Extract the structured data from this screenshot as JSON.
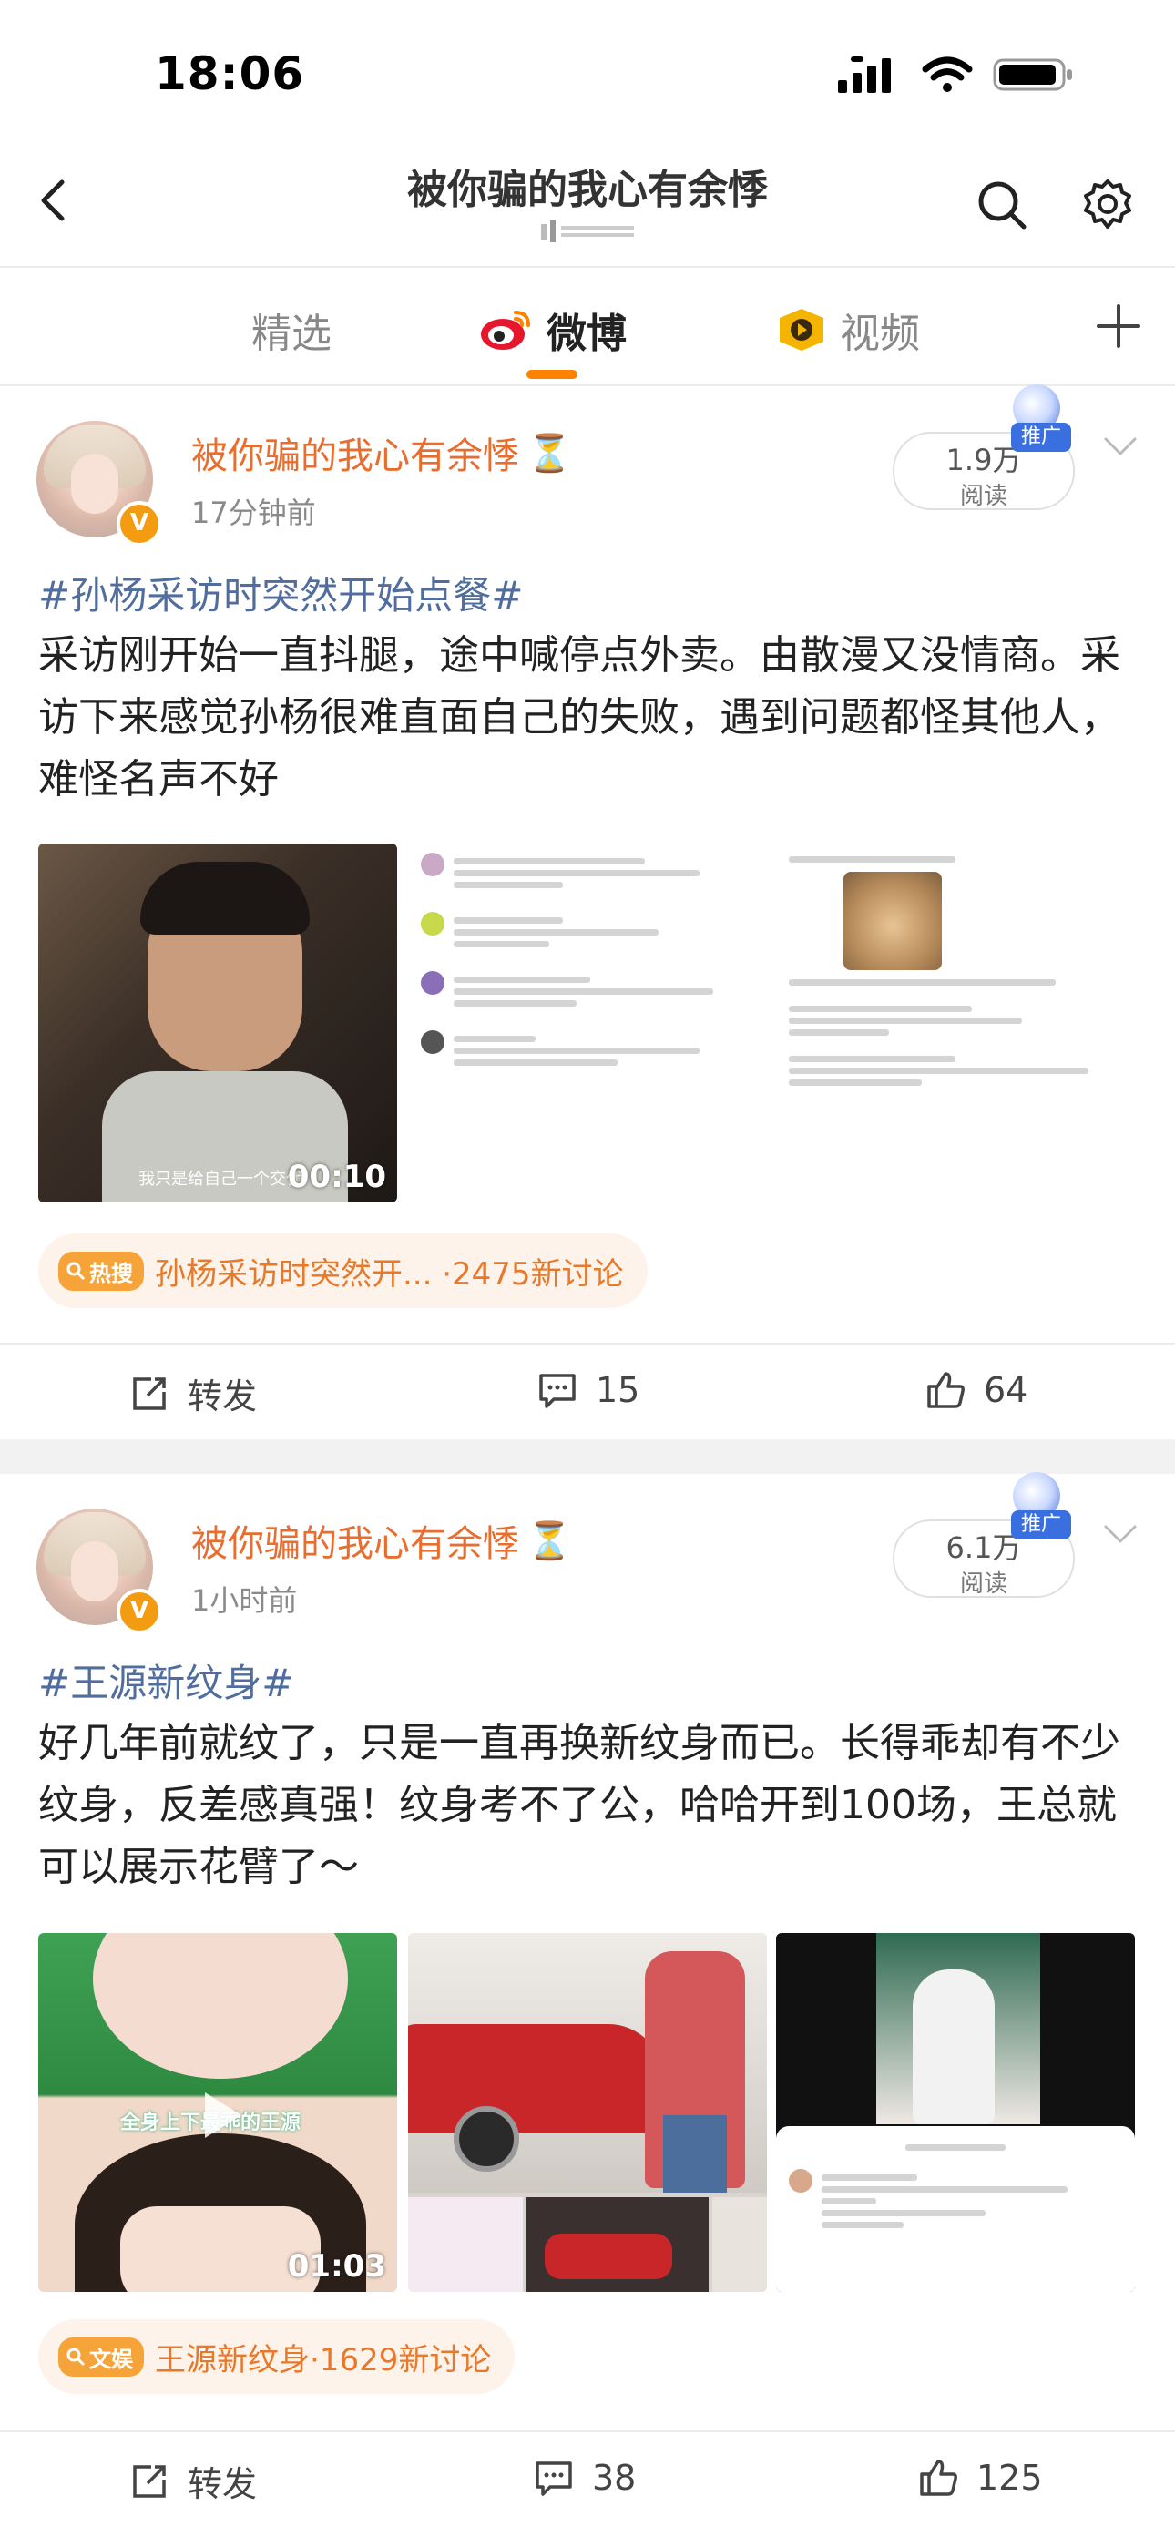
{
  "status_bar": {
    "time": "18:06"
  },
  "nav": {
    "title": "被你骗的我心有余悸"
  },
  "tabs": [
    {
      "label": "精选"
    },
    {
      "label": "微博"
    },
    {
      "label": "视频"
    }
  ],
  "posts": [
    {
      "user_name": "被你骗的我心有余悸",
      "user_emoji": "⏳",
      "time": "17分钟前",
      "read_count": "1.9万",
      "read_label": "阅读",
      "promo": "推广",
      "topic": "#孙杨采访时突然开始点餐#",
      "text": "采访刚开始一直抖腿，途中喊停点外卖。由散漫又没情商。采访下来感觉孙杨很难直面自己的失败，遇到问题都怪其他人，难怪名声不好",
      "video_duration": "00:10",
      "video_caption": "我只是给自己一个交代",
      "trend_tag": "热搜",
      "trend_text": "孙杨采访时突然开... ·2475新讨论",
      "repost_label": "转发",
      "comments": "15",
      "likes": "64"
    },
    {
      "user_name": "被你骗的我心有余悸",
      "user_emoji": "⏳",
      "time": "1小时前",
      "read_count": "6.1万",
      "read_label": "阅读",
      "promo": "推广",
      "topic": "#王源新纹身#",
      "text": "好几年前就纹了，只是一直再换新纹身而已。长得乖却有不少纹身，反差感真强！纹身考不了公，哈哈开到100场，王总就可以展示花臂了～",
      "video_duration": "01:03",
      "video_caption": "全身上下最乖的王源",
      "trend_tag": "文娱",
      "trend_text": "王源新纹身·1629新讨论",
      "repost_label": "转发",
      "comments": "38",
      "likes": "125"
    }
  ],
  "colors": {
    "accent": "#ff8200",
    "username": "#e86d2e",
    "topic": "#506d9e",
    "promo": "#3a6fe0"
  }
}
